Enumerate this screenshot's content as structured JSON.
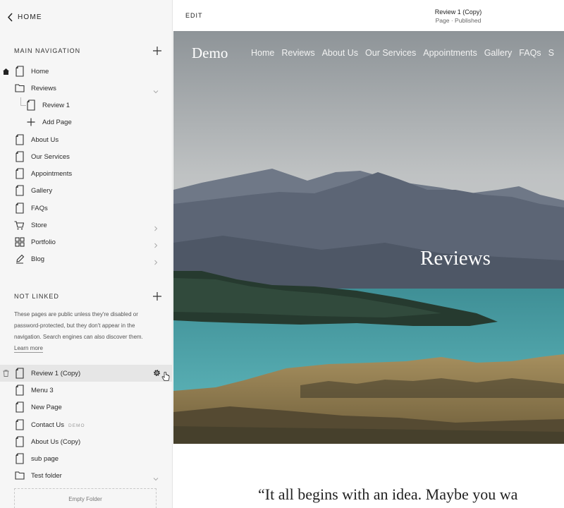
{
  "sidebar": {
    "home_label": "HOME",
    "main_nav_title": "MAIN NAVIGATION",
    "main_nav": [
      {
        "label": "Home",
        "icon": "page-icon"
      },
      {
        "label": "Reviews",
        "icon": "folder-icon"
      },
      {
        "label": "Review 1",
        "icon": "page-icon"
      },
      {
        "label": "Add Page",
        "icon": "plus-icon"
      },
      {
        "label": "About Us",
        "icon": "page-icon"
      },
      {
        "label": "Our Services",
        "icon": "page-icon"
      },
      {
        "label": "Appointments",
        "icon": "page-icon"
      },
      {
        "label": "Gallery",
        "icon": "page-icon"
      },
      {
        "label": "FAQs",
        "icon": "page-icon"
      },
      {
        "label": "Store",
        "icon": "cart-icon"
      },
      {
        "label": "Portfolio",
        "icon": "grid-icon"
      },
      {
        "label": "Blog",
        "icon": "blog-icon"
      }
    ],
    "not_linked_title": "NOT LINKED",
    "not_linked_desc": "These pages are public unless they're disabled or password-protected, but they don't appear in the navigation. Search engines can also discover them.",
    "learn_more": "Learn more",
    "not_linked": [
      {
        "label": "Review 1 (Copy)",
        "icon": "page-icon"
      },
      {
        "label": "Menu 3",
        "icon": "page-icon"
      },
      {
        "label": "New Page",
        "icon": "page-icon"
      },
      {
        "label": "Contact Us",
        "icon": "page-icon",
        "tag": "DEMO"
      },
      {
        "label": "About Us (Copy)",
        "icon": "page-icon"
      },
      {
        "label": "sub page",
        "icon": "page-icon"
      },
      {
        "label": "Test folder",
        "icon": "folder-icon"
      }
    ],
    "empty_folder": "Empty Folder"
  },
  "topbar": {
    "edit_label": "EDIT",
    "page_title": "Review 1 (Copy)",
    "page_status": "Page · Published"
  },
  "site": {
    "logo": "Demo",
    "nav": [
      "Home",
      "Reviews",
      "About Us",
      "Our Services",
      "Appointments",
      "Gallery",
      "FAQs",
      "S"
    ],
    "hero_title": "Reviews",
    "quote": "“It all begins with an idea. Maybe you wa"
  },
  "colors": {
    "sidebar_bg": "#f6f6f6",
    "selected_row": "#e6e6e6",
    "sky": "#b9bcbe",
    "lake": "#4aa0a6",
    "mountains": "#5f6878"
  }
}
